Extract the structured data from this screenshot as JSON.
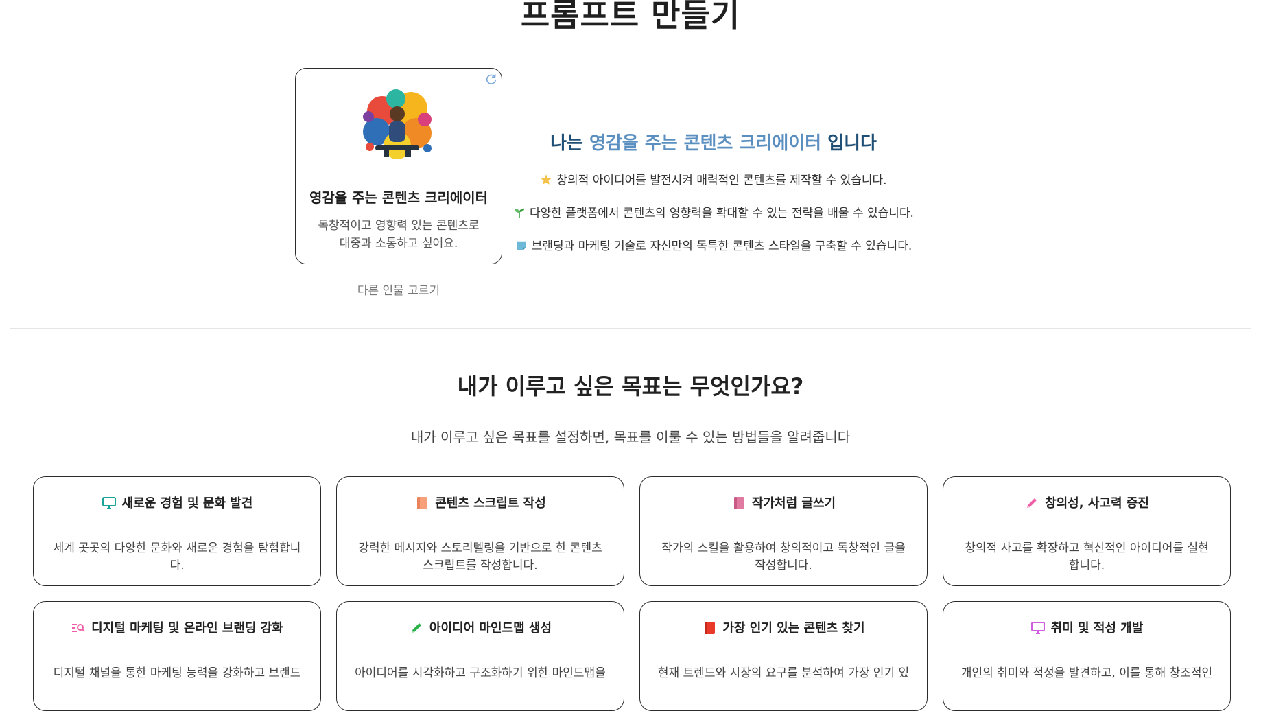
{
  "page": {
    "title": "프롬프트 만들기"
  },
  "persona": {
    "art_icon": "creator-illustration",
    "refresh_icon": "refresh-icon",
    "name": "영감을 주는 콘텐츠 크리에이터",
    "desc_line1": "독창적이고 영향력 있는 콘텐츠로",
    "desc_line2": "대중과 소통하고 싶어요.",
    "other_button": "다른 인물 고르기"
  },
  "intro": {
    "prefix": "나는",
    "highlight": "영감을 주는 콘텐츠 크리에이터",
    "suffix": "입니다",
    "features": [
      {
        "icon": "star-icon",
        "text": "창의적 아이디어를 발전시켜 매력적인 콘텐츠를 제작할 수 있습니다."
      },
      {
        "icon": "sprout-icon",
        "text": "다양한 플랫폼에서 콘텐츠의 영향력을 확대할 수 있는 전략을 배울 수 있습니다."
      },
      {
        "icon": "note-icon",
        "text": "브랜딩과 마케팅 기술로 자신만의 독특한 콘텐츠 스타일을 구축할 수 있습니다."
      }
    ]
  },
  "goals": {
    "title": "내가 이루고 싶은 목표는 무엇인가요?",
    "subtitle": "내가 이루고 싶은 목표를 설정하면, 목표를 이룰 수 있는 방법들을 알려줍니다",
    "cards": [
      {
        "icon": "monitor-icon",
        "title": "새로운 경험 및 문화 발견",
        "desc": "세계 곳곳의 다양한 문화와 새로운 경험을 탐험합니다."
      },
      {
        "icon": "book-orange-icon",
        "title": "콘텐츠 스크립트 작성",
        "desc": "강력한 메시지와 스토리텔링을 기반으로 한 콘텐츠 스크립트를 작성합니다."
      },
      {
        "icon": "book-pink-icon",
        "title": "작가처럼 글쓰기",
        "desc": "작가의 스킬을 활용하여 창의적이고 독창적인 글을 작성합니다."
      },
      {
        "icon": "pencil-icon",
        "title": "창의성, 사고력 증진",
        "desc": "창의적 사고를 확장하고 혁신적인 아이디어를 실현합니다."
      },
      {
        "icon": "search-list-icon",
        "title": "디지털 마케팅 및 온라인 브랜딩 강화",
        "desc": "디지털 채널을 통한 마케팅 능력을 강화하고 브랜드"
      },
      {
        "icon": "green-pencil-icon",
        "title": "아이디어 마인드맵 생성",
        "desc": "아이디어를 시각화하고 구조화하기 위한 마인드맵을"
      },
      {
        "icon": "red-book-icon",
        "title": "가장 인기 있는 콘텐츠 찾기",
        "desc": "현재 트렌드와 시장의 요구를 분석하여 가장 인기 있"
      },
      {
        "icon": "tv-icon",
        "title": "취미 및 적성 개발",
        "desc": "개인의 취미와 적성을 발견하고, 이를 통해 창조적인"
      }
    ]
  }
}
